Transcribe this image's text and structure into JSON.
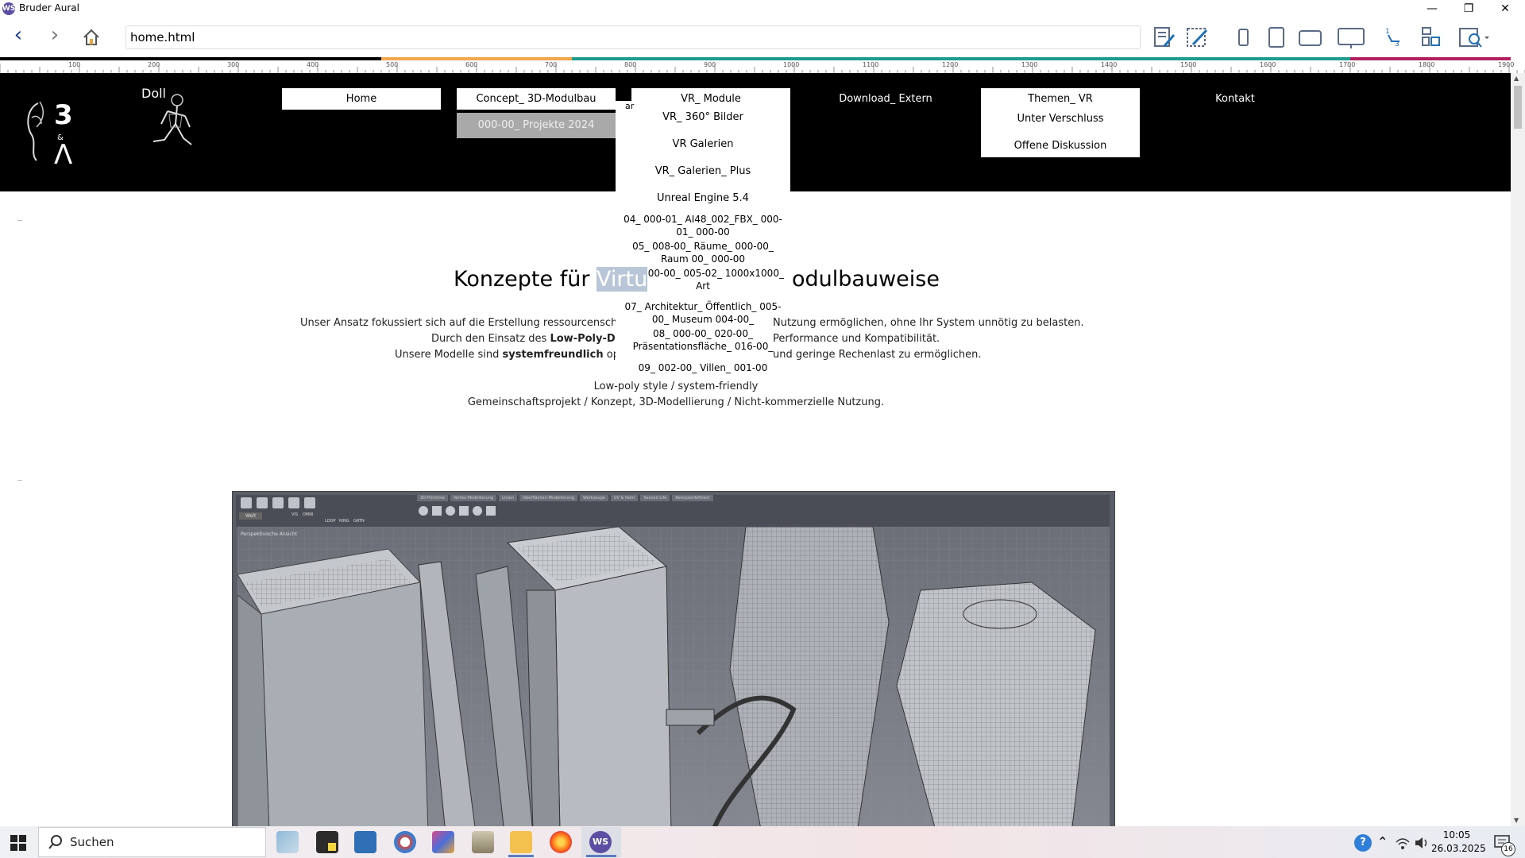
{
  "window": {
    "title": "Bruder Aural",
    "app_icon": "WS",
    "controls": [
      "—",
      "❐",
      "✕"
    ]
  },
  "toolbar": {
    "back_icon": "‹",
    "forward_icon": "›",
    "url": "home.html"
  },
  "ruler": {
    "ticks": [
      "100",
      "200",
      "300",
      "400",
      "500",
      "600",
      "700",
      "800",
      "900",
      "1000",
      "1100",
      "1200",
      "1300",
      "1400",
      "1500",
      "1600",
      "1700",
      "1800",
      "1900"
    ],
    "colors": {
      "black": "#000000",
      "orange": "#f4a64a",
      "teal": "#1f9a8e",
      "magenta": "#b0205f"
    }
  },
  "header": {
    "logo_text": "Doll",
    "menu": {
      "home": "Home",
      "concept": "Concept_ 3D-Modulbau",
      "concept_sub": "000-00_ Projekte 2024",
      "vr": "VR_ Module",
      "download": "Download_ Extern",
      "themen": "Themen_ VR",
      "kontakt": "Kontakt"
    },
    "vr_sub": [
      "VR_ 360° Bilder",
      "VR Galerien",
      "VR_ Galerien_ Plus",
      "Unreal Engine 5.4",
      "04_ 000-01_ AI48_002_FBX_ 000-01_ 000-00",
      "05_ 008-00_ Räume_ 000-00_ Raum 00_ 000-00",
      "06_ 000-00_ 005-02_ 1000x1000_ Art",
      "07_ Architektur_ Öffentlich_ 005-00_ Museum 004-00_",
      "08_ 000-00_ 020-00_ Präsentationsfläche_ 016-00_",
      "09_ 002-00_ Villen_ 001-00"
    ],
    "themen_sub": [
      "Unter Verschluss",
      "Offene Diskussion"
    ],
    "hidden_prefix": "ar"
  },
  "content": {
    "heading_left": "Konzepte für ",
    "heading_selected": "Virtu",
    "heading_right": "odulbauweise",
    "line1_left": "Unser Ansatz fokussiert sich auf die Erstellung ressourcenschonend",
    "line1_right": "Nutzung ermöglichen, ohne Ihr System unnötig zu belasten.",
    "line2_left": "Durch den Einsatz des ",
    "line2_bold": "Low-Poly-Desi",
    "line2_right": "Performance und Kompatibilität.",
    "line3_left": "Unsere Modelle sind ",
    "line3_bold": "systemfreundlich",
    "line3_mid": " optimi",
    "line3_right": "und geringe Rechenlast zu ermöglichen.",
    "tagline": "Low-poly style / system-friendly",
    "credits": "Gemeinschaftsprojekt / Konzept, 3D-Modellierung / Nicht-kommerzielle Nutzung.",
    "screenshot_tabs": [
      "3D-Primitive",
      "Vertex-Modellierung",
      "Linien",
      "Oberflächen-Modellierung",
      "Werkzeuge",
      "UV & Paint",
      "Second Life",
      "Benutzerdefiniert"
    ],
    "viewport_label": "Perspektivische Ansicht",
    "tool_labels": [
      "Welt",
      "VIS",
      "OMNI",
      "LOOP",
      "RING",
      "GRTN"
    ]
  },
  "taskbar": {
    "search_placeholder": "Suchen",
    "time": "10:05",
    "date": "26.03.2025",
    "notification_count": "16"
  }
}
